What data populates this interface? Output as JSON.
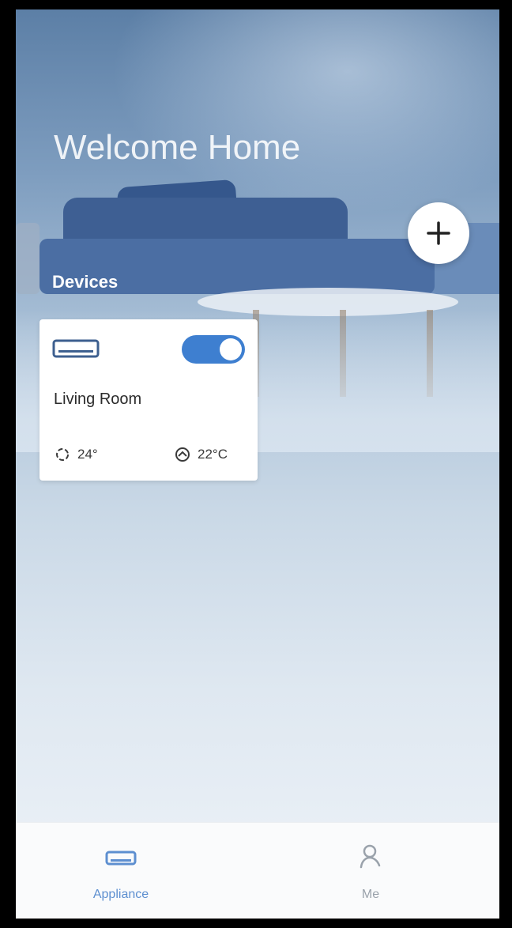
{
  "status_bar": {
    "left": "",
    "right": ""
  },
  "header": {
    "title": "Welcome Home"
  },
  "add_button": {
    "icon": "plus-icon"
  },
  "devices_section": {
    "title": "Devices",
    "devices": [
      {
        "name": "Living Room",
        "icon": "air-conditioner-icon",
        "power_on": true,
        "set_temperature": "24°",
        "indoor_temperature": "22°C"
      }
    ]
  },
  "tab_bar": {
    "tabs": [
      {
        "label": "Appliance",
        "icon": "appliance-icon",
        "active": true
      },
      {
        "label": "Me",
        "icon": "user-icon",
        "active": false
      }
    ]
  },
  "colors": {
    "accent": "#3e7fd0",
    "tab_active": "#5d8fd0",
    "tab_inactive": "#9aa2ab"
  }
}
